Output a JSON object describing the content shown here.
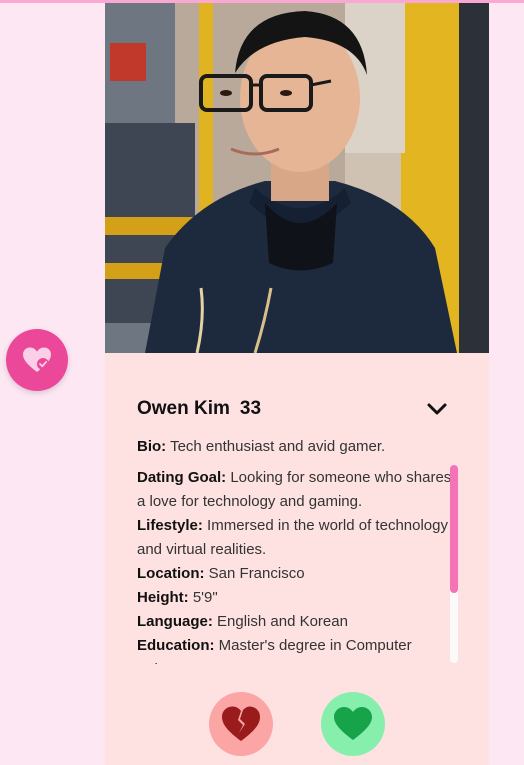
{
  "profile": {
    "name": "Owen Kim",
    "age": "33",
    "bio_label": "Bio:",
    "bio": "Tech enthusiast and avid gamer.",
    "details": [
      {
        "label": "Dating Goal:",
        "value": "Looking for someone who shares a love for technology and gaming."
      },
      {
        "label": "Lifestyle:",
        "value": "Immersed in the world of technology and virtual realities."
      },
      {
        "label": "Location:",
        "value": "San Francisco"
      },
      {
        "label": "Height:",
        "value": "5'9\""
      },
      {
        "label": "Language:",
        "value": "English and Korean"
      },
      {
        "label": "Education:",
        "value": "Master's degree in Computer Science"
      }
    ],
    "scroll_position": 0
  },
  "icons": {
    "match": "heart-check-icon",
    "expand": "chevron-down-icon",
    "pass": "broken-heart-icon",
    "like": "heart-icon"
  },
  "colors": {
    "background": "#fce7f3",
    "card": "#fee2e2",
    "accent_pink": "#ec4899",
    "pass_button": "#fca5a5",
    "pass_icon": "#991b1b",
    "like_button": "#86efac",
    "like_icon": "#16a34a",
    "scroll_thumb": "#f472b6"
  }
}
